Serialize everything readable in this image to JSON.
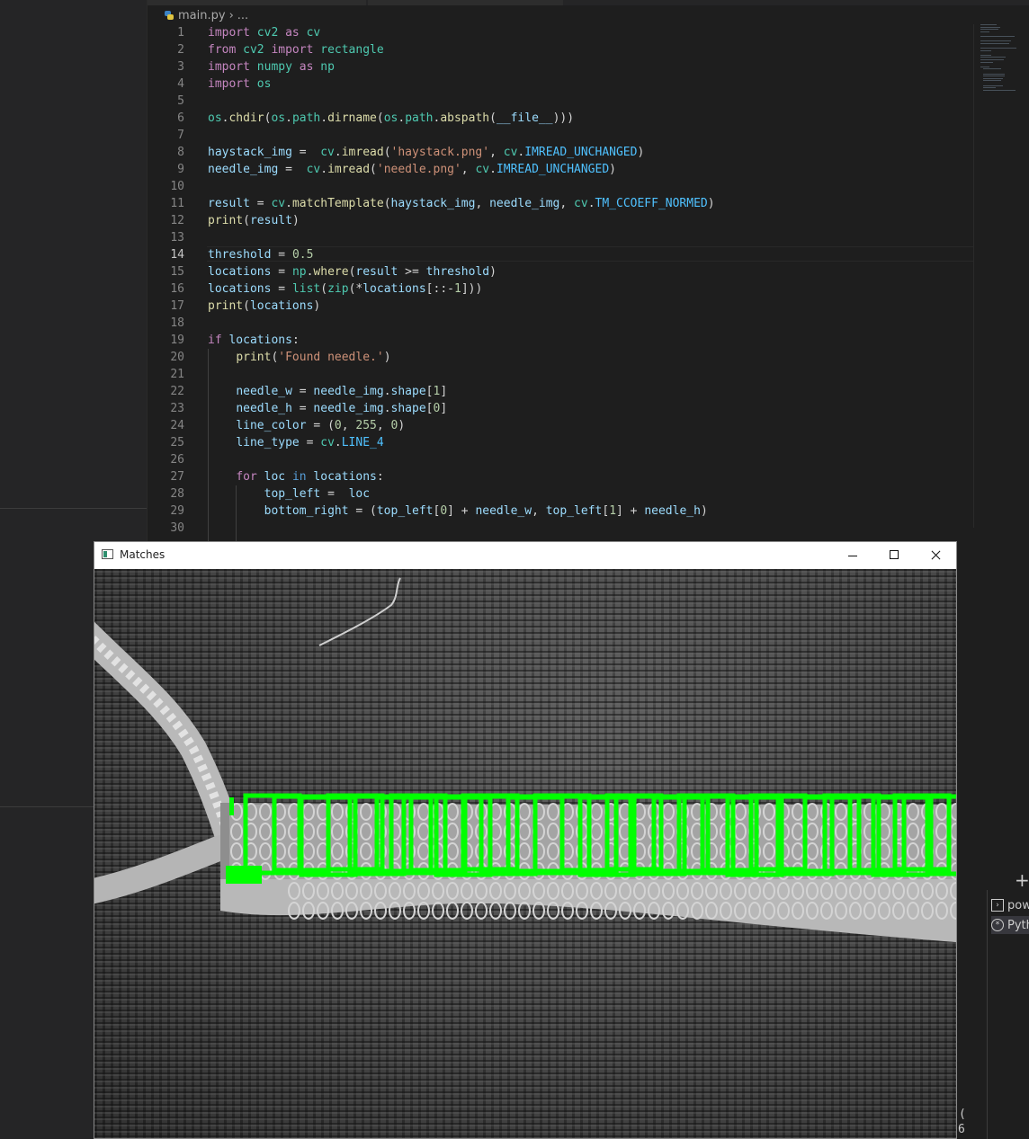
{
  "editor": {
    "breadcrumb": {
      "file": "main.py",
      "separator": "›",
      "more": "..."
    },
    "active_line": 14,
    "lines": [
      {
        "n": 1,
        "tokens": [
          [
            "kw",
            "import"
          ],
          [
            "p",
            " "
          ],
          [
            "cls",
            "cv2"
          ],
          [
            "p",
            " "
          ],
          [
            "kw",
            "as"
          ],
          [
            "p",
            " "
          ],
          [
            "cls",
            "cv"
          ]
        ]
      },
      {
        "n": 2,
        "tokens": [
          [
            "kw",
            "from"
          ],
          [
            "p",
            " "
          ],
          [
            "cls",
            "cv2"
          ],
          [
            "p",
            " "
          ],
          [
            "kw",
            "import"
          ],
          [
            "p",
            " "
          ],
          [
            "cls",
            "rectangle"
          ]
        ]
      },
      {
        "n": 3,
        "tokens": [
          [
            "kw",
            "import"
          ],
          [
            "p",
            " "
          ],
          [
            "cls",
            "numpy"
          ],
          [
            "p",
            " "
          ],
          [
            "kw",
            "as"
          ],
          [
            "p",
            " "
          ],
          [
            "cls",
            "np"
          ]
        ]
      },
      {
        "n": 4,
        "tokens": [
          [
            "kw",
            "import"
          ],
          [
            "p",
            " "
          ],
          [
            "cls",
            "os"
          ]
        ]
      },
      {
        "n": 5,
        "tokens": []
      },
      {
        "n": 6,
        "tokens": [
          [
            "cls",
            "os"
          ],
          [
            "p",
            "."
          ],
          [
            "fn",
            "chdir"
          ],
          [
            "p",
            "("
          ],
          [
            "cls",
            "os"
          ],
          [
            "p",
            "."
          ],
          [
            "cls",
            "path"
          ],
          [
            "p",
            "."
          ],
          [
            "fn",
            "dirname"
          ],
          [
            "p",
            "("
          ],
          [
            "cls",
            "os"
          ],
          [
            "p",
            "."
          ],
          [
            "cls",
            "path"
          ],
          [
            "p",
            "."
          ],
          [
            "fn",
            "abspath"
          ],
          [
            "p",
            "("
          ],
          [
            "var",
            "__file__"
          ],
          [
            "p",
            ")))"
          ]
        ]
      },
      {
        "n": 7,
        "tokens": []
      },
      {
        "n": 8,
        "tokens": [
          [
            "var",
            "haystack_img"
          ],
          [
            "p",
            " =  "
          ],
          [
            "cls",
            "cv"
          ],
          [
            "p",
            "."
          ],
          [
            "fn",
            "imread"
          ],
          [
            "p",
            "("
          ],
          [
            "str",
            "'haystack.png'"
          ],
          [
            "p",
            ", "
          ],
          [
            "cls",
            "cv"
          ],
          [
            "p",
            "."
          ],
          [
            "const",
            "IMREAD_UNCHANGED"
          ],
          [
            "p",
            ")"
          ]
        ]
      },
      {
        "n": 9,
        "tokens": [
          [
            "var",
            "needle_img"
          ],
          [
            "p",
            " =  "
          ],
          [
            "cls",
            "cv"
          ],
          [
            "p",
            "."
          ],
          [
            "fn",
            "imread"
          ],
          [
            "p",
            "("
          ],
          [
            "str",
            "'needle.png'"
          ],
          [
            "p",
            ", "
          ],
          [
            "cls",
            "cv"
          ],
          [
            "p",
            "."
          ],
          [
            "const",
            "IMREAD_UNCHANGED"
          ],
          [
            "p",
            ")"
          ]
        ]
      },
      {
        "n": 10,
        "tokens": []
      },
      {
        "n": 11,
        "tokens": [
          [
            "var",
            "result"
          ],
          [
            "p",
            " = "
          ],
          [
            "cls",
            "cv"
          ],
          [
            "p",
            "."
          ],
          [
            "fn",
            "matchTemplate"
          ],
          [
            "p",
            "("
          ],
          [
            "var",
            "haystack_img"
          ],
          [
            "p",
            ", "
          ],
          [
            "var",
            "needle_img"
          ],
          [
            "p",
            ", "
          ],
          [
            "cls",
            "cv"
          ],
          [
            "p",
            "."
          ],
          [
            "const",
            "TM_CCOEFF_NORMED"
          ],
          [
            "p",
            ")"
          ]
        ]
      },
      {
        "n": 12,
        "tokens": [
          [
            "fn",
            "print"
          ],
          [
            "p",
            "("
          ],
          [
            "var",
            "result"
          ],
          [
            "p",
            ")"
          ]
        ]
      },
      {
        "n": 13,
        "tokens": []
      },
      {
        "n": 14,
        "tokens": [
          [
            "var",
            "threshold"
          ],
          [
            "p",
            " = "
          ],
          [
            "num",
            "0.5"
          ]
        ]
      },
      {
        "n": 15,
        "tokens": [
          [
            "var",
            "locations"
          ],
          [
            "p",
            " = "
          ],
          [
            "cls",
            "np"
          ],
          [
            "p",
            "."
          ],
          [
            "fn",
            "where"
          ],
          [
            "p",
            "("
          ],
          [
            "var",
            "result"
          ],
          [
            "p",
            " >= "
          ],
          [
            "var",
            "threshold"
          ],
          [
            "p",
            ")"
          ]
        ]
      },
      {
        "n": 16,
        "tokens": [
          [
            "var",
            "locations"
          ],
          [
            "p",
            " = "
          ],
          [
            "cls",
            "list"
          ],
          [
            "p",
            "("
          ],
          [
            "cls",
            "zip"
          ],
          [
            "p",
            "(*"
          ],
          [
            "var",
            "locations"
          ],
          [
            "p",
            "[::-"
          ],
          [
            "num",
            "1"
          ],
          [
            "p",
            "]))"
          ]
        ]
      },
      {
        "n": 17,
        "tokens": [
          [
            "fn",
            "print"
          ],
          [
            "p",
            "("
          ],
          [
            "var",
            "locations"
          ],
          [
            "p",
            ")"
          ]
        ]
      },
      {
        "n": 18,
        "tokens": []
      },
      {
        "n": 19,
        "tokens": [
          [
            "kw",
            "if"
          ],
          [
            "p",
            " "
          ],
          [
            "var",
            "locations"
          ],
          [
            "p",
            ":"
          ]
        ]
      },
      {
        "n": 20,
        "tokens": [
          [
            "p",
            "    "
          ],
          [
            "fn",
            "print"
          ],
          [
            "p",
            "("
          ],
          [
            "str",
            "'Found needle.'"
          ],
          [
            "p",
            ")"
          ]
        ]
      },
      {
        "n": 21,
        "tokens": []
      },
      {
        "n": 22,
        "tokens": [
          [
            "p",
            "    "
          ],
          [
            "var",
            "needle_w"
          ],
          [
            "p",
            " = "
          ],
          [
            "var",
            "needle_img"
          ],
          [
            "p",
            "."
          ],
          [
            "var",
            "shape"
          ],
          [
            "p",
            "["
          ],
          [
            "num",
            "1"
          ],
          [
            "p",
            "]"
          ]
        ]
      },
      {
        "n": 23,
        "tokens": [
          [
            "p",
            "    "
          ],
          [
            "var",
            "needle_h"
          ],
          [
            "p",
            " = "
          ],
          [
            "var",
            "needle_img"
          ],
          [
            "p",
            "."
          ],
          [
            "var",
            "shape"
          ],
          [
            "p",
            "["
          ],
          [
            "num",
            "0"
          ],
          [
            "p",
            "]"
          ]
        ]
      },
      {
        "n": 24,
        "tokens": [
          [
            "p",
            "    "
          ],
          [
            "var",
            "line_color"
          ],
          [
            "p",
            " = ("
          ],
          [
            "num",
            "0"
          ],
          [
            "p",
            ", "
          ],
          [
            "num",
            "255"
          ],
          [
            "p",
            ", "
          ],
          [
            "num",
            "0"
          ],
          [
            "p",
            ")"
          ]
        ]
      },
      {
        "n": 25,
        "tokens": [
          [
            "p",
            "    "
          ],
          [
            "var",
            "line_type"
          ],
          [
            "p",
            " = "
          ],
          [
            "cls",
            "cv"
          ],
          [
            "p",
            "."
          ],
          [
            "const",
            "LINE_4"
          ]
        ]
      },
      {
        "n": 26,
        "tokens": []
      },
      {
        "n": 27,
        "tokens": [
          [
            "p",
            "    "
          ],
          [
            "kw",
            "for"
          ],
          [
            "p",
            " "
          ],
          [
            "var",
            "loc"
          ],
          [
            "p",
            " "
          ],
          [
            "kb",
            "in"
          ],
          [
            "p",
            " "
          ],
          [
            "var",
            "locations"
          ],
          [
            "p",
            ":"
          ]
        ]
      },
      {
        "n": 28,
        "tokens": [
          [
            "p",
            "        "
          ],
          [
            "var",
            "top_left"
          ],
          [
            "p",
            " =  "
          ],
          [
            "var",
            "loc"
          ]
        ]
      },
      {
        "n": 29,
        "tokens": [
          [
            "p",
            "        "
          ],
          [
            "var",
            "bottom_right"
          ],
          [
            "p",
            " = ("
          ],
          [
            "var",
            "top_left"
          ],
          [
            "p",
            "["
          ],
          [
            "num",
            "0"
          ],
          [
            "p",
            "] + "
          ],
          [
            "var",
            "needle_w"
          ],
          [
            "p",
            ", "
          ],
          [
            "var",
            "top_left"
          ],
          [
            "p",
            "["
          ],
          [
            "num",
            "1"
          ],
          [
            "p",
            "] + "
          ],
          [
            "var",
            "needle_h"
          ],
          [
            "p",
            ")"
          ]
        ]
      },
      {
        "n": 30,
        "tokens": []
      }
    ]
  },
  "matches_window": {
    "title": "Matches",
    "match_color": "#00ff00"
  },
  "panel": {
    "add_label": "+",
    "terminals": [
      {
        "icon": "terminal-icon",
        "label": "powershell"
      },
      {
        "icon": "debug-icon",
        "label": "Python Debug Console"
      }
    ],
    "edge_char_1": "(",
    "edge_char_2": "6"
  },
  "colors": {
    "editor_bg": "#1e1e1e",
    "sidebar_bg": "#252526",
    "keyword": "#c586c0",
    "function": "#dcdcaa",
    "variable": "#9cdcfe",
    "type": "#4ec9b0",
    "string": "#ce9178",
    "number": "#b5cea8",
    "constant": "#4fc1ff"
  }
}
